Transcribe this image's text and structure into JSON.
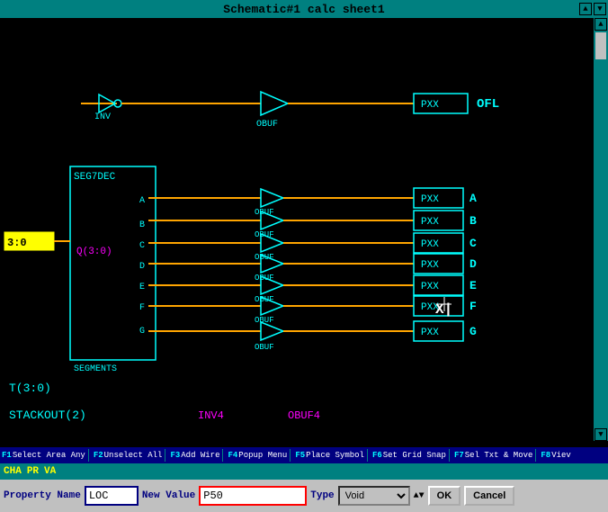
{
  "titleBar": {
    "title": "Schematic#1 calc sheet1",
    "buttons": [
      "▲",
      "▼"
    ]
  },
  "schematic": {
    "components": [
      {
        "id": "inv",
        "label": "INV"
      },
      {
        "id": "obuf_top",
        "label": "OBUF"
      },
      {
        "id": "pxx_ofl",
        "label": "PXX"
      },
      {
        "id": "ofl_label",
        "label": "OFL"
      },
      {
        "id": "seg7dec",
        "label": "SEG7DEC"
      },
      {
        "id": "q30",
        "label": "Q(3:0)"
      },
      {
        "id": "segments",
        "label": "SEGMENTS"
      },
      {
        "id": "bus_label",
        "label": "3:0"
      },
      {
        "id": "t30",
        "label": "T(3:0)"
      },
      {
        "id": "stackout",
        "label": "STACKOUT(2)"
      },
      {
        "id": "inv4",
        "label": "INV4"
      },
      {
        "id": "obuf4",
        "label": "OBUF4"
      }
    ],
    "ports": [
      "A",
      "B",
      "C",
      "D",
      "E",
      "F",
      "G"
    ],
    "pxx_labels": [
      "PXX",
      "PXX",
      "PXX",
      "PXX",
      "PXX",
      "PXX",
      "PXX"
    ],
    "out_labels": [
      "A",
      "B",
      "C",
      "D",
      "E",
      "F",
      "G"
    ]
  },
  "fkeys": [
    {
      "key": "F1",
      "label": "Select Area Any"
    },
    {
      "key": "F2",
      "label": "Unselect All"
    },
    {
      "key": "F3",
      "label": "Add Wire"
    },
    {
      "key": "F4",
      "label": "Popup Menu"
    },
    {
      "key": "F5",
      "label": "Place Symbol"
    },
    {
      "key": "F6",
      "label": "Set Grid Snap"
    },
    {
      "key": "F7",
      "label": "Sel Txt & Move"
    },
    {
      "key": "F8",
      "label": "Viev"
    }
  ],
  "propertyBar": {
    "row1_items": [
      {
        "label": "CHA",
        "value": ""
      },
      {
        "label": "PR",
        "value": ""
      },
      {
        "label": "VA",
        "value": ""
      }
    ],
    "property_name_label": "Property Name",
    "property_name_value": "LOC",
    "new_value_label": "New Value",
    "new_value_value": "P50",
    "type_label": "Type",
    "type_value": "Void",
    "ok_label": "OK",
    "cancel_label": "Cancel"
  }
}
